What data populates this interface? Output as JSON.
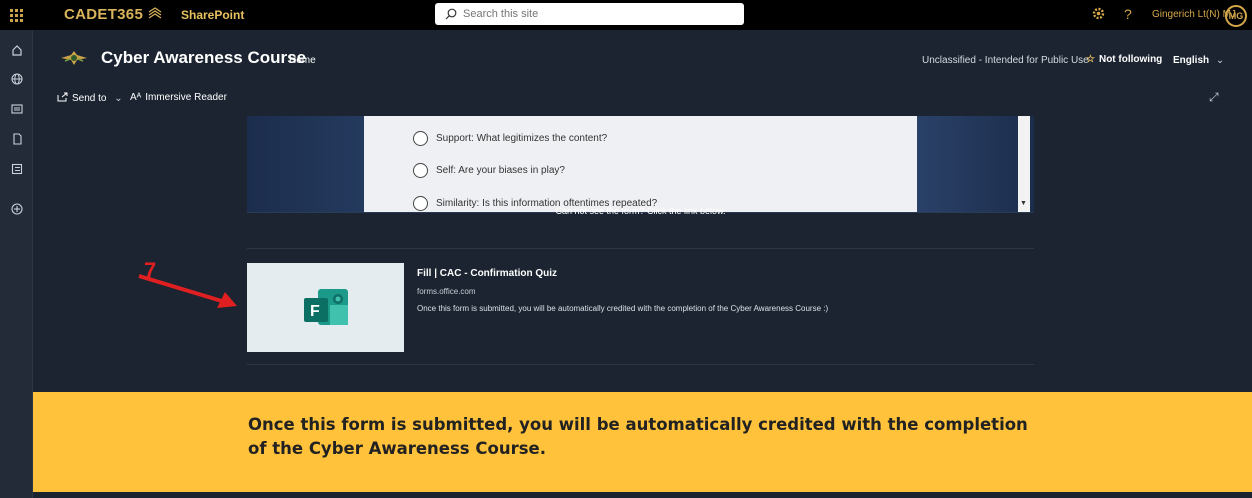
{
  "topbar": {
    "brand": "CADET365",
    "suite": "SharePoint",
    "search_placeholder": "Search this site",
    "user_name": "Gingerich Lt(N) MJ",
    "avatar_initials": "MG"
  },
  "header": {
    "site_title": "Cyber Awareness Course",
    "nav_home": "Home",
    "classification": "Unclassified - Intended for Public Use",
    "follow_label": "Not following",
    "language": "English"
  },
  "commandbar": {
    "send_to": "Send to",
    "immersive_reader": "Immersive Reader"
  },
  "form_embed": {
    "options": [
      "Support: What legitimizes the content?",
      "Self: Are your biases in play?",
      "Similarity: Is this information oftentimes repeated?"
    ],
    "cant_see_text": "Can not see the form? Click the link below."
  },
  "link_card": {
    "title": "Fill | CAC - Confirmation Quiz",
    "domain": "forms.office.com",
    "description": "Once this form is submitted, you will be automatically credited with the completion of the Cyber Awareness Course :)"
  },
  "annotation": {
    "number": "7",
    "color": "#e02020"
  },
  "banner": {
    "text": "Once this form is submitted, you will be automatically credited with the completion of the Cyber Awareness Course."
  },
  "colors": {
    "banner_bg": "#ffc23a",
    "page_bg": "#1b2430",
    "accent_gold": "#d4a84b"
  }
}
